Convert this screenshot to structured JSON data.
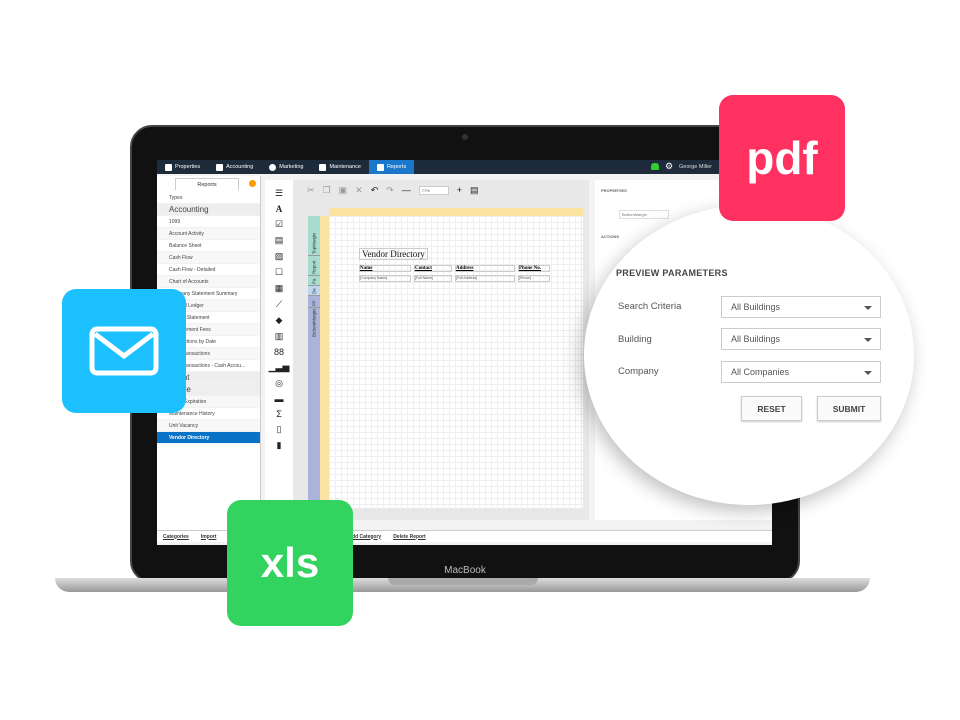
{
  "laptop": {
    "brand": "MacBook"
  },
  "topnav": {
    "items": [
      {
        "label": "Properties",
        "icon": "person-icon"
      },
      {
        "label": "Accounting",
        "icon": "calculator-icon"
      },
      {
        "label": "Marketing",
        "icon": "globe-icon"
      },
      {
        "label": "Maintenance",
        "icon": "tools-icon"
      },
      {
        "label": "Reports",
        "icon": "clipboard-icon",
        "active": true
      }
    ],
    "user": "George Miller"
  },
  "sidebar": {
    "tab": "Reports",
    "items": [
      {
        "label": "Types"
      },
      {
        "label": "Accounting",
        "header": true
      },
      {
        "label": "1099"
      },
      {
        "label": "Account Activity"
      },
      {
        "label": "Balance Sheet"
      },
      {
        "label": "Cash Flow"
      },
      {
        "label": "Cash Flow - Detailed"
      },
      {
        "label": "Chart of Accounts"
      },
      {
        "label": "Company Statement Summary"
      },
      {
        "label": "General Ledger"
      },
      {
        "label": "Income Statement"
      },
      {
        "label": "Management Fees"
      },
      {
        "label": "Transactions by Date"
      },
      {
        "label": "Trust Transactions"
      },
      {
        "label": "Trust Transactions - Cash Accou..."
      },
      {
        "label": "Client",
        "header": true
      },
      {
        "label": "Lease",
        "header": true
      },
      {
        "label": "Lease Expiration"
      },
      {
        "label": "Maintenance History"
      },
      {
        "label": "Unit Vacancy"
      },
      {
        "label": "Vendor Directory",
        "selected": true
      }
    ]
  },
  "bottombar": {
    "links": [
      "Categories",
      "Import",
      "Add Category",
      "Delete Report"
    ]
  },
  "designer": {
    "zoom": "77%",
    "report_title": "Vendor Directory",
    "columns": [
      "Name",
      "Contact",
      "Address",
      "Phone No."
    ],
    "fields": [
      "[Company Name]",
      "[Full Name]",
      "[Full Address]",
      "[Phone]"
    ],
    "bands": [
      "TopMargin",
      "Report",
      "Pa",
      "De",
      "PF",
      "BottomMargin"
    ]
  },
  "properties": {
    "label": "PROPERTIES",
    "value": "BottomMargin",
    "actions": "ACTIONS"
  },
  "preview": {
    "title": "PREVIEW PARAMETERS",
    "params": [
      {
        "label": "Search Criteria",
        "value": "All Buildings"
      },
      {
        "label": "Building",
        "value": "All Buildings"
      },
      {
        "label": "Company",
        "value": "All Companies"
      }
    ],
    "reset": "RESET",
    "submit": "SUBMIT"
  },
  "badges": {
    "pdf": "pdf",
    "xls": "xls",
    "pdf_color": "#ff3160",
    "mail_color": "#1cc0ff",
    "xls_color": "#32d35f"
  }
}
